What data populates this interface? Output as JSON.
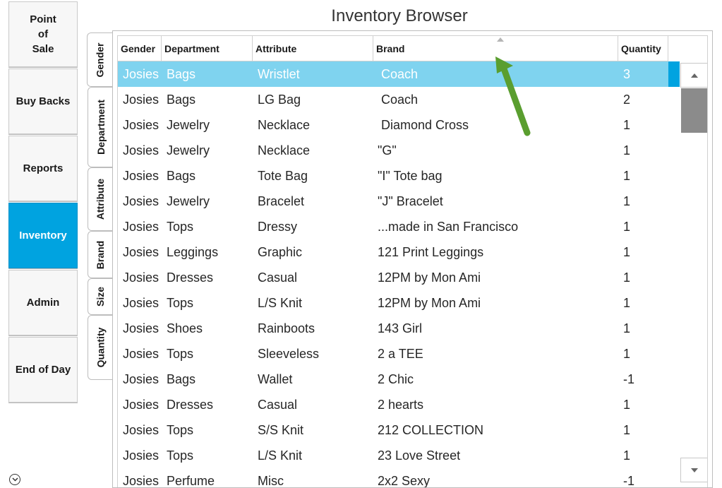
{
  "title": "Inventory Browser",
  "nav": [
    {
      "label": "Point\nof\nSale",
      "active": false
    },
    {
      "label": "Buy Backs",
      "active": false
    },
    {
      "label": "Reports",
      "active": false
    },
    {
      "label": "Inventory",
      "active": true
    },
    {
      "label": "Admin",
      "active": false
    },
    {
      "label": "End of Day",
      "active": false
    }
  ],
  "tabs": [
    "Gender",
    "Department",
    "Attribute",
    "Brand",
    "Size",
    "Quantity"
  ],
  "selected_tab": "Gender",
  "columns": [
    "Gender",
    "Department",
    "Attribute",
    "Brand",
    "Quantity"
  ],
  "sorted_column": "Brand",
  "rows": [
    {
      "gender": "Josies",
      "department": "Bags",
      "attribute": "Wristlet",
      "brand": " Coach",
      "quantity": "3"
    },
    {
      "gender": "Josies",
      "department": "Bags",
      "attribute": "LG Bag",
      "brand": " Coach",
      "quantity": "2"
    },
    {
      "gender": "Josies",
      "department": "Jewelry",
      "attribute": "Necklace",
      "brand": " Diamond Cross",
      "quantity": "1"
    },
    {
      "gender": "Josies",
      "department": "Jewelry",
      "attribute": "Necklace",
      "brand": "\"G\"",
      "quantity": "1"
    },
    {
      "gender": "Josies",
      "department": "Bags",
      "attribute": "Tote Bag",
      "brand": "\"I\" Tote bag",
      "quantity": "1"
    },
    {
      "gender": "Josies",
      "department": "Jewelry",
      "attribute": "Bracelet",
      "brand": "\"J\" Bracelet",
      "quantity": "1"
    },
    {
      "gender": "Josies",
      "department": "Tops",
      "attribute": "Dressy",
      "brand": "...made in San Francisco",
      "quantity": "1"
    },
    {
      "gender": "Josies",
      "department": "Leggings",
      "attribute": "Graphic",
      "brand": "121 Print Leggings",
      "quantity": "1"
    },
    {
      "gender": "Josies",
      "department": "Dresses",
      "attribute": "Casual",
      "brand": "12PM by Mon Ami",
      "quantity": "1"
    },
    {
      "gender": "Josies",
      "department": "Tops",
      "attribute": "L/S Knit",
      "brand": "12PM by Mon Ami",
      "quantity": "1"
    },
    {
      "gender": "Josies",
      "department": "Shoes",
      "attribute": "Rainboots",
      "brand": "143 Girl",
      "quantity": "1"
    },
    {
      "gender": "Josies",
      "department": "Tops",
      "attribute": "Sleeveless",
      "brand": "2 a TEE",
      "quantity": "1"
    },
    {
      "gender": "Josies",
      "department": "Bags",
      "attribute": "Wallet",
      "brand": "2 Chic",
      "quantity": "-1"
    },
    {
      "gender": "Josies",
      "department": "Dresses",
      "attribute": "Casual",
      "brand": "2 hearts",
      "quantity": "1"
    },
    {
      "gender": "Josies",
      "department": "Tops",
      "attribute": "S/S Knit",
      "brand": "212 COLLECTION",
      "quantity": "1"
    },
    {
      "gender": "Josies",
      "department": "Tops",
      "attribute": "L/S Knit",
      "brand": "23 Love Street",
      "quantity": "1"
    },
    {
      "gender": "Josies",
      "department": "Perfume",
      "attribute": "Misc",
      "brand": "2x2 Sexy",
      "quantity": "-1"
    }
  ],
  "selected_row": 0,
  "icons": {
    "collapse": "chevron-down-circle-icon",
    "scroll_up": "triangle-up-icon",
    "scroll_down": "triangle-down-icon",
    "sort": "sort-ascending-icon",
    "annotation": "green-arrow-icon"
  },
  "colors": {
    "accent": "#00a3e0",
    "selected_row": "#7fd3ef",
    "annotation_arrow": "#5a9e2f"
  }
}
